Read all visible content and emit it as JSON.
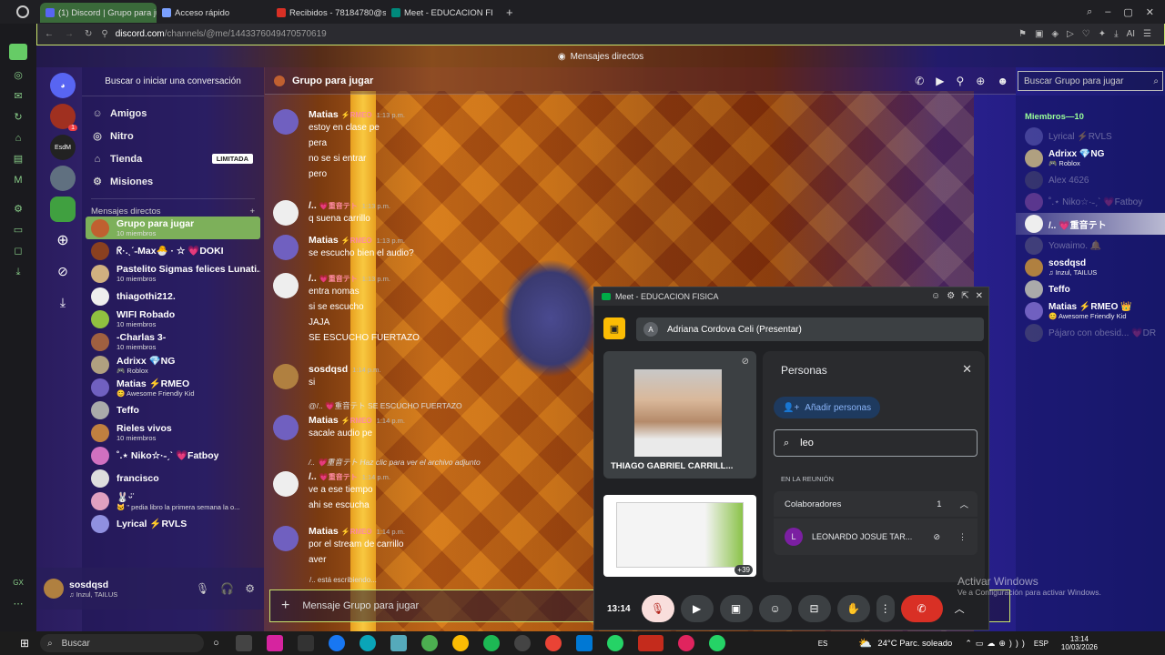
{
  "browser": {
    "tabs": [
      {
        "title": "(1) Discord | Grupo para ju",
        "color": "#5865f2",
        "active": true
      },
      {
        "title": "Acceso rápido",
        "color": "#7aa0ff",
        "active": false
      },
      {
        "title": "Recibidos - 78184780@s",
        "color": "#d93025",
        "active": false
      },
      {
        "title": "Meet - EDUCACION FI",
        "color": "#00897b",
        "active": false
      }
    ],
    "url_domain": "discord.com",
    "url_path": "/channels/@me/1443376049470570619"
  },
  "discord": {
    "window_title": "Mensajes directos",
    "search_placeholder": "Buscar o iniciar una conversación",
    "nav": [
      {
        "label": "Amigos",
        "icon": "friends-icon"
      },
      {
        "label": "Nitro",
        "icon": "nitro-icon"
      },
      {
        "label": "Tienda",
        "icon": "shop-icon",
        "badge": "LIMITADA"
      },
      {
        "label": "Misiones",
        "icon": "quests-icon"
      }
    ],
    "dm_header": "Mensajes directos",
    "dm_add": "+",
    "server_badge": "1",
    "server_label": "EsdM",
    "dms": [
      {
        "name": "Grupo para jugar",
        "sub": "10 miembros",
        "color": "#c06030",
        "active": true
      },
      {
        "name": "ᖇ·.ˎˊ˗Max🐣 · ☆  💗DOKI",
        "sub": "",
        "color": "#8a4020"
      },
      {
        "name": "Pastelito Sigmas felices Lunati...",
        "sub": "10 miembros",
        "color": "#d0b080"
      },
      {
        "name": "thiagothi212.",
        "sub": "",
        "color": "#eeeeee"
      },
      {
        "name": "WIFI Robado",
        "sub": "10 miembros",
        "color": "#90c040"
      },
      {
        "name": "-Charlas 3-",
        "sub": "10 miembros",
        "color": "#a06040"
      },
      {
        "name": "Adrixx  💎NG",
        "sub": "🎮 Roblox",
        "color": "#b0a080"
      },
      {
        "name": "Matias  ⚡RMEO",
        "sub": "😊 Awesome Friendly Kid",
        "color": "#7060c0"
      },
      {
        "name": "Teffo",
        "sub": "",
        "color": "#aaaaaa"
      },
      {
        "name": "Rieles vivos",
        "sub": "10 miembros",
        "color": "#c08040"
      },
      {
        "name": "˚.⋆ Niko☆·˗ˏˋ  💗Fatboy",
        "sub": "",
        "color": "#d070c0"
      },
      {
        "name": "francisco",
        "sub": "",
        "color": "#dddddd"
      },
      {
        "name": "🐰ᵕ̈",
        "sub": "🐱 \" pedia libro la primera semana la o...",
        "color": "#e0a0c0"
      },
      {
        "name": "Lyrical  ⚡RVLS",
        "sub": "",
        "color": "#9090e0"
      }
    ],
    "user": {
      "name": "sosdqsd",
      "status": "♫ Inzul, TAILUS"
    },
    "channel": {
      "title": "Grupo para jugar",
      "search": "Buscar Grupo para jugar",
      "composer_placeholder": "Mensaje Grupo para jugar",
      "typing": "/.. está escribiendo..."
    },
    "messages": [
      {
        "author": "Matias",
        "tag": "⚡RMEO",
        "time": "1:13 p.m.",
        "lines": [
          "estoy en clase pe",
          "pera",
          "no se si entrar",
          "pero"
        ],
        "color": "#7060c0"
      },
      {
        "author": "/..",
        "tag": "💗重音テト",
        "time": "1:13 p.m.",
        "lines": [
          "q suena carrillo"
        ],
        "color": "#eeeeee"
      },
      {
        "author": "Matias",
        "tag": "⚡RMEO",
        "time": "1:13 p.m.",
        "lines": [
          "se escucho bien el audio?"
        ],
        "color": "#7060c0"
      },
      {
        "author": "/..",
        "tag": "💗重音テト",
        "time": "1:13 p.m.",
        "lines": [
          "entra nomas",
          "si se escucho",
          "JAJA",
          "SE ESCUCHO FUERTAZO"
        ],
        "color": "#eeeeee"
      },
      {
        "author": "sosdqsd",
        "tag": "",
        "time": "1:14 p.m.",
        "lines": [
          "si"
        ],
        "color": "#b08040"
      },
      {
        "author": "Matias",
        "tag": "⚡RMEO",
        "time": "1:14 p.m.",
        "reply": "@/.. 💗重音テト  SE ESCUCHO FUERTAZO",
        "lines": [
          "sacale audio pe"
        ],
        "color": "#7060c0"
      },
      {
        "author": "/..",
        "tag": "💗重音テト",
        "time": "1:14 p.m.",
        "reply": "/.. 💗重音テト  Haz clic para ver el archivo adjunto",
        "lines": [
          "ve a ese tiempo",
          "ahi se escucha"
        ],
        "color": "#eeeeee"
      },
      {
        "author": "Matias",
        "tag": "⚡RMEO",
        "time": "1:14 p.m.",
        "lines": [
          "por el stream de carrillo",
          "aver"
        ],
        "color": "#7060c0"
      }
    ],
    "members_header": "Miembros—10",
    "members": [
      {
        "name": "Lyrical  ⚡RVLS",
        "sub": "",
        "dim": true
      },
      {
        "name": "Adrixx  💎NG",
        "sub": "🎮 Roblox",
        "dim": false
      },
      {
        "name": "Alex 4626",
        "sub": "",
        "dim": true
      },
      {
        "name": "˚.⋆ Niko☆·˗ˏˋ  💗Fatboy",
        "sub": "",
        "dim": true
      },
      {
        "name": "/..  💗重音テト",
        "sub": "",
        "dim": false
      },
      {
        "name": "Yowaimo. 🔔",
        "sub": "",
        "dim": true
      },
      {
        "name": "sosdqsd",
        "sub": "♫ Inzul, TAILUS",
        "dim": false
      },
      {
        "name": "Teffo",
        "sub": "",
        "dim": false
      },
      {
        "name": "Matias  ⚡RMEO 👑",
        "sub": "😊 Awesome Friendly Kid",
        "dim": false
      },
      {
        "name": "Pájaro con obesid...  💗DR",
        "sub": "",
        "dim": true
      }
    ]
  },
  "meet": {
    "title": "Meet - EDUCACION FISICA",
    "presenter": "Adriana Cordova Celi (Presentar)",
    "presenter_initial": "A",
    "tile_name": "THIAGO GABRIEL CARRILL...",
    "tile2_count": "+39",
    "people_title": "Personas",
    "add_people": "Añadir personas",
    "search_value": "leo",
    "section": "EN LA REUNIÓN",
    "group": "Colaboradores",
    "group_count": "1",
    "participant": "LEONARDO JOSUE TAR...",
    "participant_initial": "L",
    "clock": "13:14"
  },
  "watermark": {
    "line1": "Activar Windows",
    "line2": "Ve a Configuración para activar Windows."
  },
  "taskbar": {
    "search": "Buscar",
    "lang": "ES",
    "weather": "24°C  Parc. soleado",
    "kbd": "ESP",
    "time": "13:14",
    "date": "10/03/2026"
  }
}
